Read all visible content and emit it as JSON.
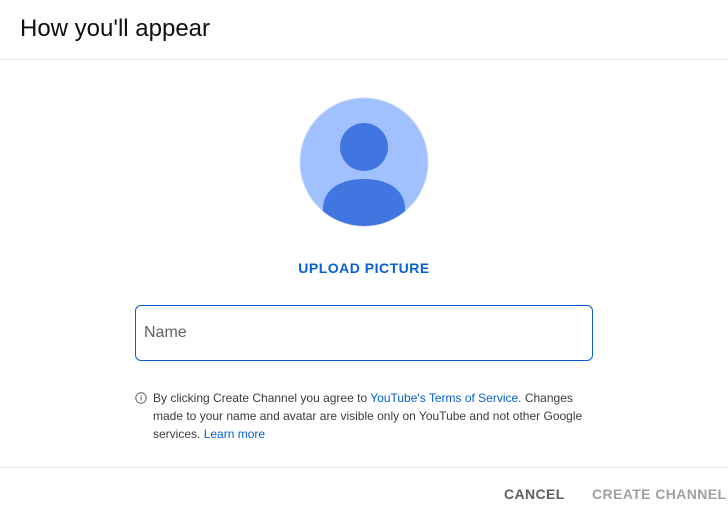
{
  "dialog": {
    "title": "How you'll appear"
  },
  "avatar": {
    "icon": "default-avatar-icon",
    "bg_color": "#a0c0ff",
    "figure_color": "#4175e0"
  },
  "upload": {
    "label": "UPLOAD PICTURE"
  },
  "name_field": {
    "value": "",
    "placeholder": "Name"
  },
  "notice": {
    "icon": "info-icon",
    "text_before": "By clicking Create Channel you agree to ",
    "tos_link": "YouTube's Terms of Service",
    "text_after": ". Changes made to your name and avatar are visible only on YouTube and not other Google services. ",
    "learn_more": "Learn more"
  },
  "footer": {
    "cancel_label": "CANCEL",
    "create_label": "CREATE CHANNEL"
  },
  "colors": {
    "accent": "#065fd4",
    "disabled": "#a0a0a0"
  }
}
